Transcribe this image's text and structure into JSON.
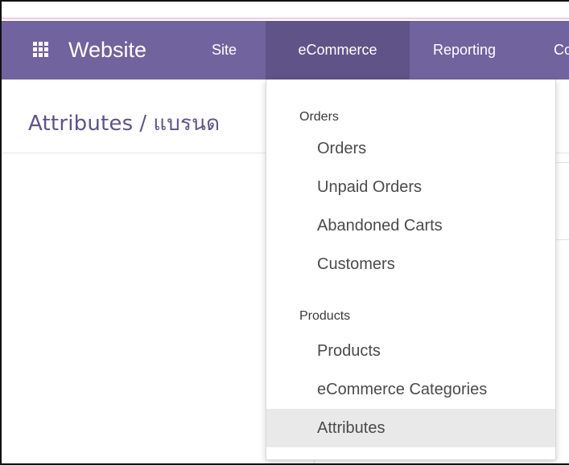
{
  "navbar": {
    "apps_icon": "apps-grid-icon",
    "brand": "Website",
    "items": [
      {
        "label": "Site"
      },
      {
        "label": "eCommerce"
      },
      {
        "label": "Reporting"
      },
      {
        "label": "Co"
      }
    ]
  },
  "breadcrumb": {
    "parent": "Attributes",
    "separator": "/",
    "current": "แบรนด"
  },
  "dropdown": {
    "sections": [
      {
        "header": "Orders",
        "items": [
          "Orders",
          "Unpaid Orders",
          "Abandoned Carts",
          "Customers"
        ]
      },
      {
        "header": "Products",
        "items": [
          "Products",
          "eCommerce Categories",
          "Attributes"
        ]
      }
    ],
    "active_item": "Attributes"
  },
  "colors": {
    "navbar_bg": "#71639e",
    "navbar_active_bg": "#5f5388",
    "breadcrumb_text": "#5f5388",
    "active_item_bg": "#e9e9e9"
  }
}
